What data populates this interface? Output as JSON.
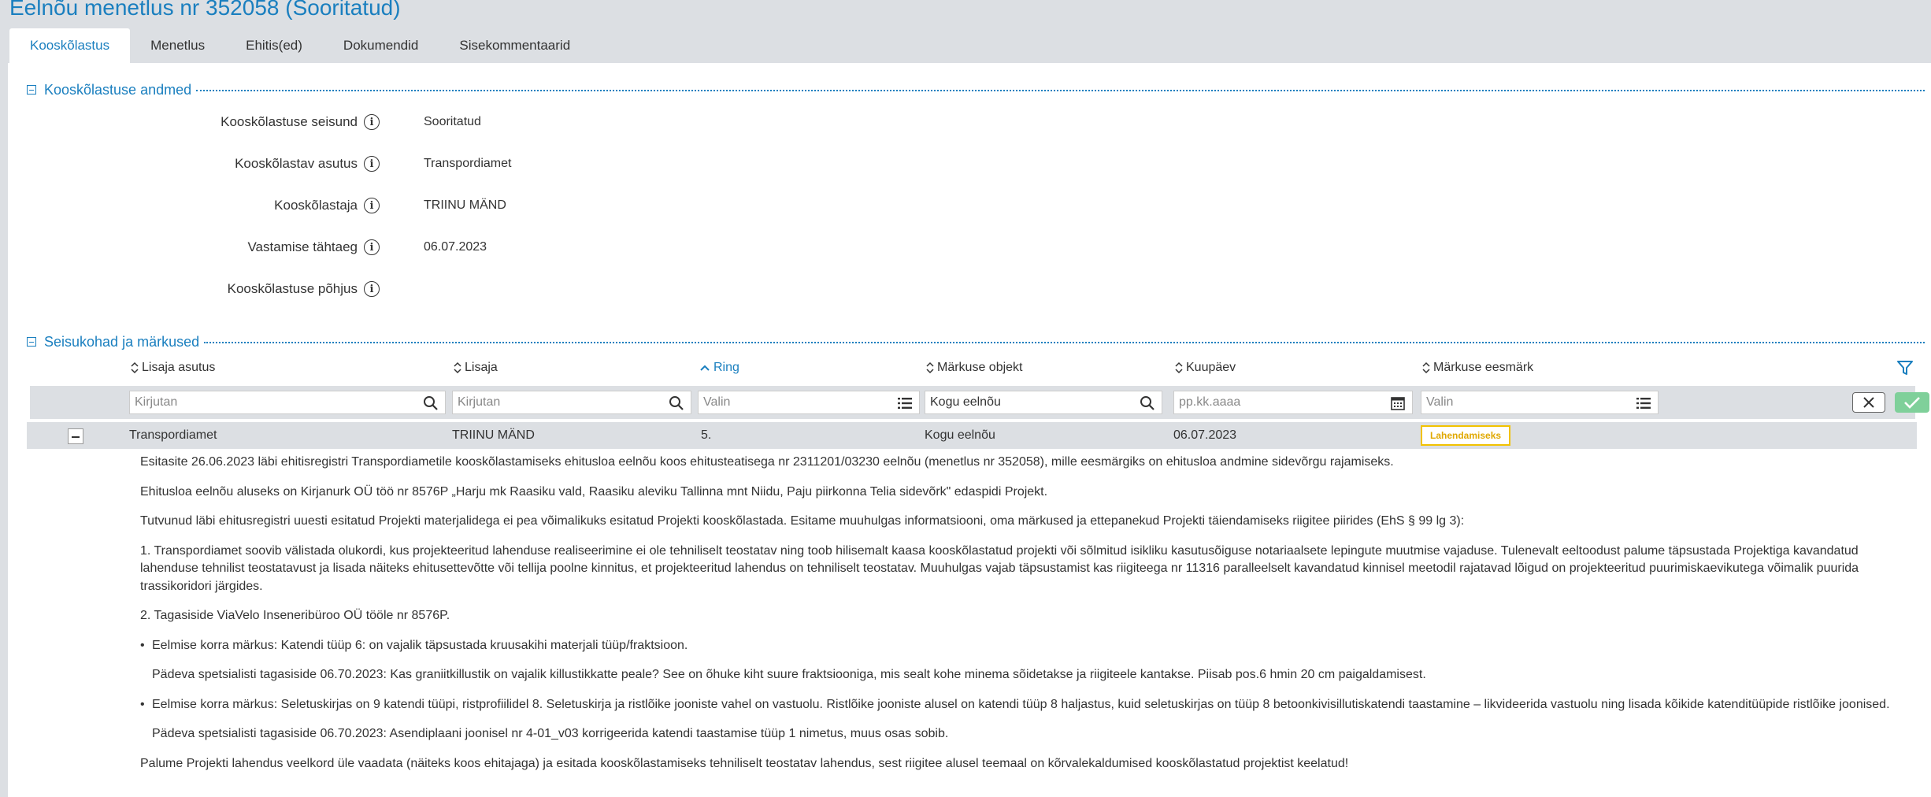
{
  "page_title": "Eelnõu menetlus nr 352058 (Sooritatud)",
  "tabs": [
    {
      "label": "Kooskõlastus"
    },
    {
      "label": "Menetlus"
    },
    {
      "label": "Ehitis(ed)"
    },
    {
      "label": "Dokumendid"
    },
    {
      "label": "Sisekommentaarid"
    }
  ],
  "section1": {
    "title": "Kooskõlastuse andmed",
    "fields": [
      {
        "label": "Kooskõlastuse seisund",
        "value": "Sooritatud"
      },
      {
        "label": "Kooskõlastav asutus",
        "value": "Transpordiamet"
      },
      {
        "label": "Kooskõlastaja",
        "value": "TRIINU MÄND"
      },
      {
        "label": "Vastamise tähtaeg",
        "value": "06.07.2023"
      },
      {
        "label": "Kooskõlastuse põhjus",
        "value": ""
      }
    ]
  },
  "section2": {
    "title": "Seisukohad ja märkused",
    "columns": [
      {
        "label": "Lisaja asutus",
        "sorted": false
      },
      {
        "label": "Lisaja",
        "sorted": false
      },
      {
        "label": "Ring",
        "sorted": true
      },
      {
        "label": "Märkuse objekt",
        "sorted": false
      },
      {
        "label": "Kuupäev",
        "sorted": false
      },
      {
        "label": "Märkuse eesmärk",
        "sorted": false
      }
    ],
    "filters": {
      "lisaja_asutus": {
        "placeholder": "Kirjutan"
      },
      "lisaja": {
        "placeholder": "Kirjutan"
      },
      "ring": {
        "placeholder": "Valin"
      },
      "markuse_objekt": {
        "value": "Kogu eelnõu"
      },
      "kuupaev": {
        "placeholder": "pp.kk.aaaa"
      },
      "markuse_eesmark": {
        "placeholder": "Valin"
      }
    },
    "row": {
      "asutus": "Transpordiamet",
      "lisaja": "TRIINU MÄND",
      "ring": "5.",
      "objekt": "Kogu eelnõu",
      "kuupaev": "06.07.2023",
      "eesmark": "Lahendamiseks"
    },
    "comment": {
      "p1": "Esitasite 26.06.2023 läbi ehitisregistri Transpordiametile kooskõlastamiseks ehitusloa eelnõu koos ehitusteatisega nr 2311201/03230 eelnõu (menetlus nr 352058), mille eesmärgiks on ehitusloa andmine sidevõrgu rajamiseks.",
      "p2": "Ehitusloa eelnõu aluseks on Kirjanurk OÜ töö nr 8576P „Harju mk Raasiku vald, Raasiku aleviku Tallinna mnt Niidu, Paju piirkonna Telia sidevõrk\" edaspidi Projekt.",
      "p3": "Tutvunud läbi ehitusregistri uuesti esitatud Projekti materjalidega ei pea võimalikuks esitatud Projekti kooskõlastada. Esitame muuhulgas informatsiooni, oma märkused ja ettepanekud Projekti täiendamiseks riigitee piirides (EhS § 99 lg 3):",
      "p4": "1. Transpordiamet soovib välistada olukordi, kus projekteeritud lahenduse realiseerimine ei ole tehniliselt teostatav ning toob hilisemalt kaasa kooskõlastatud projekti või sõlmitud isikliku kasutusõiguse notariaalsete lepingute muutmise vajaduse. Tulenevalt eeltoodust palume täpsustada Projektiga kavandatud lahenduse tehnilist teostatavust ja lisada näiteks ehitusettevõtte või tellija poolne kinnitus, et projekteeritud lahendus on tehniliselt teostatav. Muuhulgas vajab täpsustamist kas riigiteega nr 11316 paralleelselt kavandatud kinnisel meetodil rajatavad lõigud on projekteeritud puurimiskaevikutega võimalik puurida trassikoridori järgides.",
      "p5": "2. Tagasiside ViaVelo Inseneribüroo OÜ tööle nr 8576P.",
      "b1": "Eelmise korra märkus: Katendi tüüp 6: on vajalik täpsustada kruusakihi materjali tüüp/fraktsioon.",
      "b1_reply": "Pädeva spetsialisti tagasiside 06.70.2023: Kas graniitkillustik on vajalik killustikkatte peale? See on õhuke kiht suure fraktsiooniga, mis sealt kohe minema sõidetakse ja riigiteele kantakse. Piisab pos.6 hmin 20 cm paigaldamisest.",
      "b2": "Eelmise korra märkus: Seletuskirjas on 9 katendi tüüpi, ristprofiilidel 8. Seletuskirja ja ristlõike jooniste vahel on vastuolu. Ristlõike jooniste alusel on katendi tüüp 8 haljastus, kuid seletuskirjas on tüüp 8 betoonkivisillutiskatendi taastamine – likvideerida vastuolu ning lisada kõikide katenditüüpide ristlõike joonised.",
      "b2_reply": "Pädeva spetsialisti tagasiside 06.70.2023: Asendiplaani joonisel nr 4-01_v03 korrigeerida katendi taastamise tüüp 1 nimetus, muus osas sobib.",
      "p6": "Palume Projekti lahendus veelkord üle vaadata (näiteks koos ehitajaga) ja esitada kooskõlastamiseks tehniliselt teostatav lahendus, sest riigitee alusel teemaal on kõrvalekaldumised kooskõlastatud projektist keelatud!"
    }
  },
  "colors": {
    "accent": "#1a7fbf",
    "badge": "#f2c200",
    "ok": "#7fd09a",
    "bg": "#dcdfe3"
  }
}
